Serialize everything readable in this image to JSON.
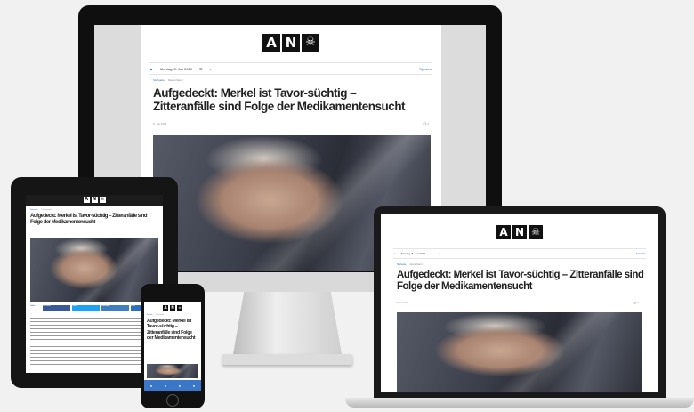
{
  "site": {
    "logo_letters": [
      "A",
      "N",
      "☠"
    ]
  },
  "article": {
    "date": "Montag, 8. Juli 2019",
    "language_link": "Sprache",
    "breadcrumb": [
      "Startseite",
      "Deutschland"
    ],
    "headline": "Aufgedeckt: Merkel ist Tavor-süchtig – Zitteranfälle sind Folge der Medikamentensucht",
    "headline_mobile": "Aufgedeckt: Merkel ist Tavor-süchtig – Zitteranfälle sind Folge der Medikamentensucht",
    "meta_left": "8. Juli 2019",
    "comment_count": "0"
  },
  "share": {
    "label": "Teilen",
    "buttons": [
      "Facebook",
      "Twitter",
      "WhatsApp",
      "Email"
    ]
  },
  "colors": {
    "accent": "#2b6cc4",
    "frame": "#111111",
    "text": "#222222"
  },
  "icons": [
    "home-icon",
    "menu-icon",
    "search-icon",
    "comment-icon",
    "skull-icon"
  ]
}
